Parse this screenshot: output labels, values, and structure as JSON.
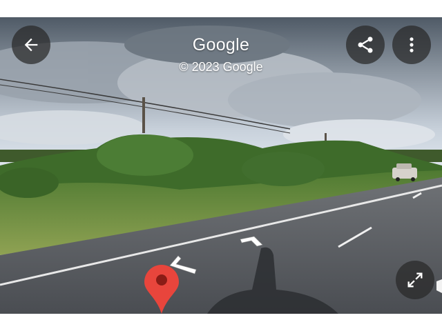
{
  "viewer": {
    "title": "Google",
    "copyright": "© 2023 Google"
  },
  "controls": {
    "back": {
      "icon": "arrow-left-icon"
    },
    "share": {
      "icon": "share-icon"
    },
    "more": {
      "icon": "more-vert-icon"
    },
    "expand": {
      "icon": "expand-icon"
    }
  },
  "colors": {
    "pin": "#e8453c",
    "control_bg": "#282828"
  }
}
